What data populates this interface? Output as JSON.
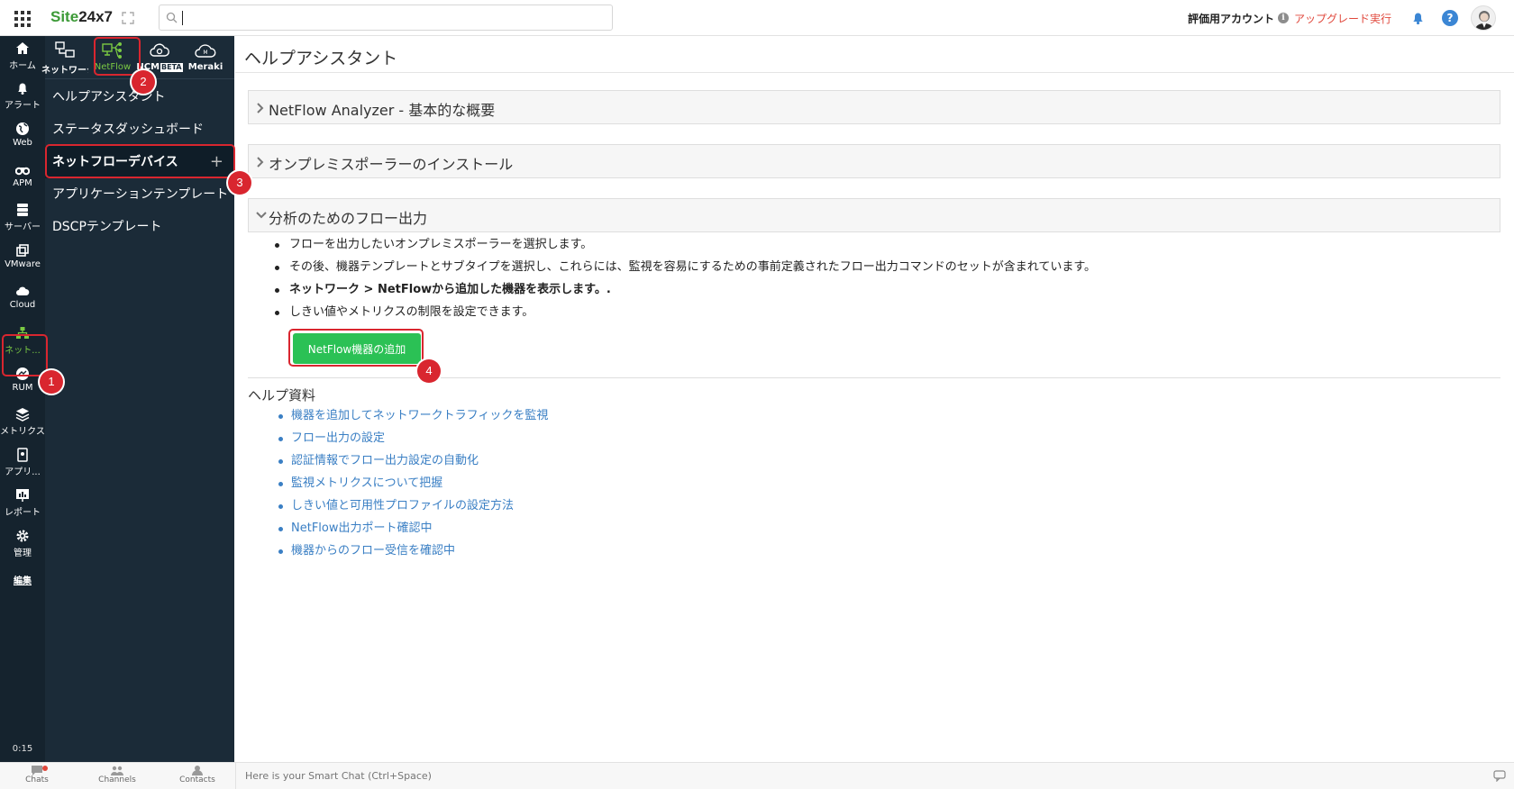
{
  "topbar": {
    "logo_site": "Site",
    "logo_num": "24x7",
    "search_value": "",
    "account_label": "評価用アカウント",
    "upgrade_label": "アップグレード実行"
  },
  "rail": {
    "items": [
      {
        "label": "ホーム",
        "icon": "home-icon"
      },
      {
        "label": "アラート",
        "icon": "bell-icon"
      },
      {
        "label": "Web",
        "icon": "globe-icon"
      },
      {
        "label": "APM",
        "icon": "binoculars-icon"
      },
      {
        "label": "サーバー",
        "icon": "server-icon"
      },
      {
        "label": "VMware",
        "icon": "vmware-icon"
      },
      {
        "label": "Cloud",
        "icon": "cloud-icon"
      },
      {
        "label": "ネット...",
        "icon": "network-icon"
      },
      {
        "label": "RUM",
        "icon": "rum-icon"
      },
      {
        "label": "メトリクス",
        "icon": "layers-icon"
      },
      {
        "label": "アプリ...",
        "icon": "app-icon"
      },
      {
        "label": "レポート",
        "icon": "report-icon"
      },
      {
        "label": "管理",
        "icon": "gear-icon"
      },
      {
        "label": "編集",
        "icon": ""
      }
    ],
    "time": "0:15"
  },
  "subtabs": [
    {
      "label": "ネットワーク",
      "icon": "network-devices-icon"
    },
    {
      "label": "NetFlow",
      "icon": "netflow-icon"
    },
    {
      "label": "NCM",
      "icon": "ncm-icon",
      "beta": "BETA"
    },
    {
      "label": "Meraki",
      "icon": "meraki-icon"
    }
  ],
  "submenu": {
    "items": [
      "ヘルプアシスタント",
      "ステータスダッシュボード",
      "ネットフローデバイス",
      "アプリケーションテンプレート",
      "DSCPテンプレート"
    ],
    "plus": "+"
  },
  "main": {
    "title": "ヘルプアシスタント",
    "accordions": [
      "NetFlow Analyzer - 基本的な概要",
      "オンプレミスポーラーのインストール",
      "分析のためのフロー出力"
    ],
    "bullets": [
      "フローを出力したいオンプレミスポーラーを選択します。",
      "その後、機器テンプレートとサブタイプを選択し、これらには、監視を容易にするための事前定義されたフロー出力コマンドのセットが含まれています。",
      "ネットワーク > NetFlowから追加した機器を表示します。.",
      "しきい値やメトリクスの制限を設定できます。"
    ],
    "add_button": "NetFlow機器の追加",
    "help_title": "ヘルプ資料",
    "links": [
      "機器を追加してネットワークトラフィックを監視",
      "フロー出力の設定",
      "認証情報でフロー出力設定の自動化",
      "監視メトリクスについて把握",
      "しきい値と可用性プロファイルの設定方法",
      "NetFlow出力ポート確認中",
      "機器からのフロー受信を確認中"
    ]
  },
  "badges": [
    "1",
    "2",
    "3",
    "4"
  ],
  "bottom": {
    "chats": "Chats",
    "channels": "Channels",
    "contacts": "Contacts",
    "smart_chat_placeholder": "Here is your Smart Chat (Ctrl+Space)"
  },
  "colors": {
    "rail_bg": "#15232e",
    "panel_bg": "#1b2b38",
    "accent_green": "#2bc155",
    "highlight_red": "#d9262f",
    "link_blue": "#3a7fc4"
  }
}
